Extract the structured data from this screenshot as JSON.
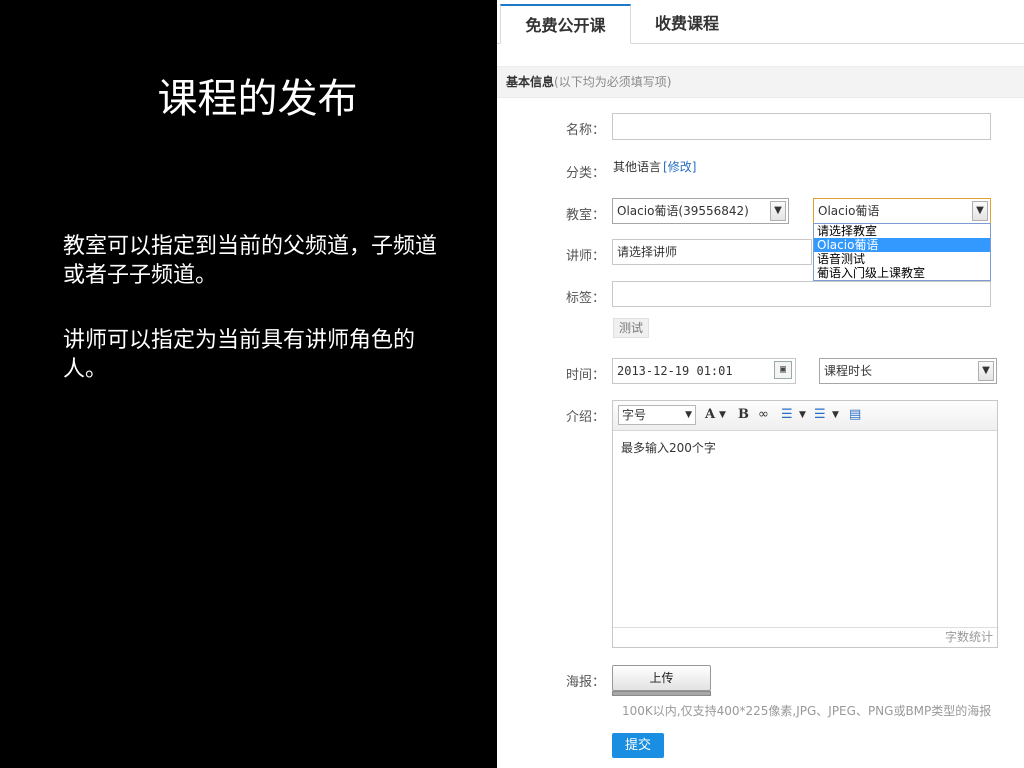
{
  "slide": {
    "title": "课程的发布",
    "paragraph1": "教室可以指定到当前的父频道，子频道或者子子频道。",
    "paragraph2": "讲师可以指定为当前具有讲师角色的人。"
  },
  "tabs": [
    {
      "label": "免费公开课",
      "active": true
    },
    {
      "label": "收费课程",
      "active": false
    }
  ],
  "section": {
    "title": "基本信息",
    "note": "(以下均为必须填写项)"
  },
  "form": {
    "name_label": "名称：",
    "name_value": "",
    "category_label": "分类：",
    "category_value": "其他语言",
    "category_edit": "[修改]",
    "classroom_label": "教室：",
    "channel_selected": "Olacio葡语(39556842)",
    "room_selected": "Olacio葡语",
    "room_options": [
      "请选择教室",
      "Olacio葡语",
      "语音测试",
      "葡语入门级上课教室"
    ],
    "room_options_highlighted": 1,
    "teacher_label": "讲师：",
    "teacher_placeholder": "请选择讲师",
    "tags_label": "标签：",
    "tags_value": "",
    "tag_chip": "测试",
    "time_label": "时间：",
    "time_value": "2013-12-19 01:01",
    "duration_selected": "课程时长",
    "intro_label": "介绍：",
    "font_size_label": "字号",
    "toolbar_font_color": "A",
    "toolbar_bold": "B",
    "intro_placeholder": "最多输入200个字",
    "word_count_label": "字数统计",
    "poster_label": "海报：",
    "upload_label": "上传",
    "poster_hint": "100K以内,仅支持400*225像素,JPG、JPEG、PNG或BMP类型的海报",
    "submit_label": "提交"
  },
  "colors": {
    "accent": "#1e78c8",
    "submit": "#1a8ee0",
    "highlight": "#3399ff",
    "link": "#2a6fc4"
  }
}
